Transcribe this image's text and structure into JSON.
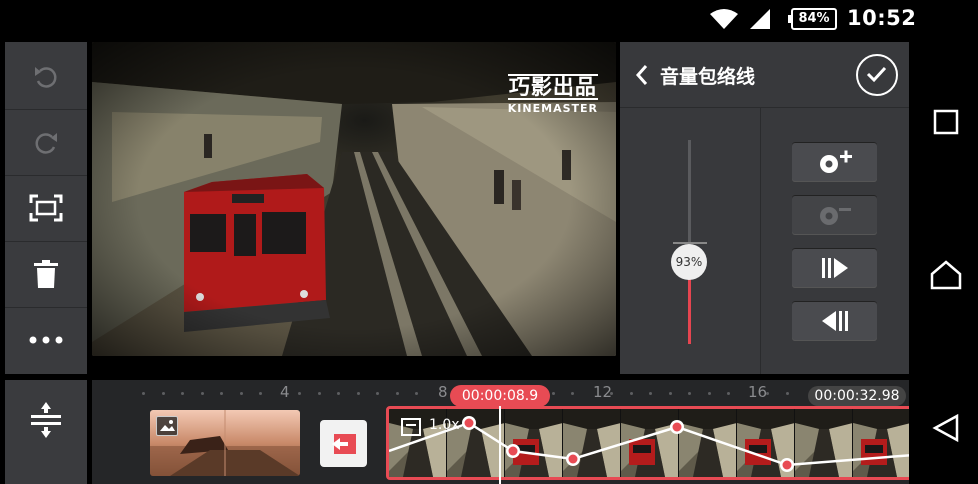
{
  "status_bar": {
    "battery": "84%",
    "time": "10:52",
    "icons": [
      "wifi-icon",
      "signal-icon",
      "battery-icon"
    ]
  },
  "toolbar": {
    "items": [
      {
        "name": "undo",
        "icon": "undo-icon"
      },
      {
        "name": "redo",
        "icon": "redo-icon"
      },
      {
        "name": "crop",
        "icon": "crop-fullscreen-icon"
      },
      {
        "name": "delete",
        "icon": "trash-icon"
      },
      {
        "name": "more",
        "icon": "more-dots-icon"
      }
    ],
    "bottom_icon": "timeline-expand-icon"
  },
  "preview": {
    "watermark_cn": "巧影出品",
    "watermark_en": "KINEMASTER"
  },
  "panel": {
    "title": "音量包络线",
    "volume_label": "93%",
    "volume_fraction": 0.47,
    "buttons": [
      {
        "name": "add-keyframe",
        "icon": "add-keyframe-icon",
        "enabled": true
      },
      {
        "name": "remove-keyframe",
        "icon": "remove-keyframe-icon",
        "enabled": false
      },
      {
        "name": "next-keyframe",
        "icon": "next-keyframe-icon",
        "enabled": true
      },
      {
        "name": "prev-keyframe",
        "icon": "prev-keyframe-icon",
        "enabled": true
      }
    ]
  },
  "timeline": {
    "ruler_labels": [
      "4",
      "8",
      "12",
      "16"
    ],
    "current_time": "00:00:08.9",
    "total_time": "00:00:32.98",
    "clip_speed": "1.0x"
  },
  "colors": {
    "accent": "#e84b54",
    "panel_bg": "#38393c",
    "toolbar_bg": "#3a3b3e",
    "timeline_bg": "#252628"
  }
}
